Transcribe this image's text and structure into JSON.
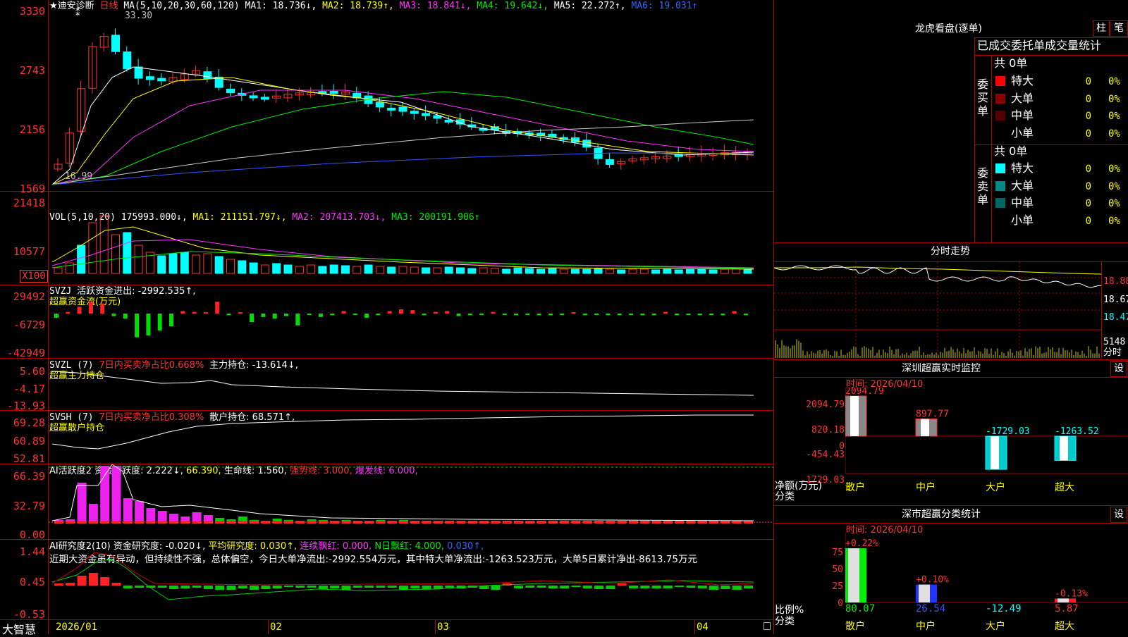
{
  "stock": {
    "name_line": "★迪安诊断",
    "period": "日线",
    "ma_label": "MA(5,10,20,30,60,120)",
    "ma": [
      "MA1: 18.736↓,",
      "MA2: 18.739↑,",
      "MA3: 18.841↓,",
      "MA4: 19.642↓,",
      "MA5: 22.272↑,",
      "MA6: 19.031↑"
    ],
    "high_mark": "33.30",
    "low_mark": "16.99",
    "y_ticks": [
      "3330",
      "2743",
      "2156",
      "1569"
    ]
  },
  "vol": {
    "label": "VOL(5,10,20)",
    "value": "175993.000↓,",
    "ma": [
      "MA1: 211151.797↓,",
      "MA2: 207413.703↓,",
      "MA3: 200191.906↑"
    ],
    "y_ticks": [
      "21418",
      "10577",
      "X100"
    ]
  },
  "svzj": {
    "label": "SVZJ",
    "text": "活跃资金进出: -2992.535↑,",
    "sub": "超赢资金流(万元)",
    "y_ticks": [
      "29492",
      "-6729",
      "-42949"
    ]
  },
  "svzl": {
    "label": "SVZL (7)",
    "ratio": "7日内买卖净占比0.668%",
    "text": "主力持仓: -13.614↓,",
    "sub": "超赢主力持仓",
    "y_ticks": [
      "5.60",
      "-4.17",
      "-13.93"
    ]
  },
  "svsh": {
    "label": "SVSH (7)",
    "ratio": "7日内买卖净占比0.308%",
    "text": "散户持仓: 68.571↑,",
    "sub": "超赢散户持仓",
    "y_ticks": [
      "69.28",
      "60.89",
      "52.81"
    ]
  },
  "ai1": {
    "label": "AI活跃度2",
    "items": [
      "资金活跃度: 2.222↓,",
      "66.390,",
      "生命线: 1.560,",
      "强势线: 3.000,",
      "爆发线: 6.000,"
    ],
    "y_ticks": [
      "66.39",
      "32.79",
      "0.00"
    ]
  },
  "ai2": {
    "label": "AI研究度2(10)",
    "items": [
      "资金研究度: -0.020↓,",
      "平均研究度: 0.030↑,",
      "连续飘红: 0.000,",
      "N日飘红: 4.000,",
      "0.030↑,"
    ],
    "note": "近期大资金虽有异动，但持续性不强，总体偏空，今日大单净流出:-2992.554万元，其中特大单净流出:-1263.523万元，大单5日累计净出-8613.75万元",
    "y_ticks": [
      "1.44",
      "0.45",
      "-0.53"
    ]
  },
  "xaxis": [
    "2026/01",
    "02",
    "03",
    "04"
  ],
  "brand": "大智慧",
  "lhb": {
    "title": "龙虎看盘(逐单)",
    "btn1": "柱",
    "btn2": "笔",
    "subtitle": "已成交委托单成交量统计",
    "buy_label": "委买单",
    "sell_label": "委卖单",
    "buy_total": "共 0单",
    "sell_total": "共 0单",
    "buy_rows": [
      {
        "name": "特大",
        "count": "0",
        "pct": "0%",
        "color": "#ff0000"
      },
      {
        "name": "大单",
        "count": "0",
        "pct": "0%",
        "color": "#880000"
      },
      {
        "name": "中单",
        "count": "0",
        "pct": "0%",
        "color": "#550000"
      },
      {
        "name": "小单",
        "count": "0",
        "pct": "0%",
        "color": "#000000"
      }
    ],
    "sell_rows": [
      {
        "name": "特大",
        "count": "0",
        "pct": "0%",
        "color": "#00ffff"
      },
      {
        "name": "大单",
        "count": "0",
        "pct": "0%",
        "color": "#008888"
      },
      {
        "name": "中单",
        "count": "0",
        "pct": "0%",
        "color": "#006666"
      },
      {
        "name": "小单",
        "count": "0",
        "pct": "0%",
        "color": "#000000"
      }
    ]
  },
  "intraday": {
    "title": "分时走势",
    "y_ticks": [
      "18.88",
      "18.67",
      "18.47"
    ],
    "vol_label": "5148",
    "time_label": "分时"
  },
  "monitor": {
    "title": "深圳超赢实时监控",
    "set": "设",
    "time": "时间: 2026/04/10",
    "y_ticks": [
      "2094.79",
      "820.18",
      "0",
      "-454.43",
      "-1729.03"
    ],
    "ylab1": "净额(万元)",
    "ylab2": "分类",
    "bars": [
      {
        "cat": "散户",
        "value": 2094.79,
        "label": "2094.79"
      },
      {
        "cat": "中户",
        "value": 897.77,
        "label": "897.77"
      },
      {
        "cat": "大户",
        "value": -1729.03,
        "label": "-1729.03"
      },
      {
        "cat": "超大",
        "value": -1263.52,
        "label": "-1263.52"
      }
    ]
  },
  "classify": {
    "title": "深市超赢分类统计",
    "set": "设",
    "time": "时间: 2026/04/10",
    "y_ticks": [
      "75",
      "50",
      "25",
      "0"
    ],
    "ylab1": "比例%",
    "ylab2": "分类",
    "bars": [
      {
        "cat": "散户",
        "value": 80.07,
        "label": "80.07",
        "top": "+0.22%"
      },
      {
        "cat": "中户",
        "value": 26.54,
        "label": "26.54",
        "top": "+0.10%"
      },
      {
        "cat": "大户",
        "value": -12.49,
        "label": "-12.49",
        "top": ""
      },
      {
        "cat": "超大",
        "value": 5.87,
        "label": "5.87",
        "top": "-0.13%"
      }
    ]
  },
  "chart_data": {
    "type": "bar",
    "title": "深圳超赢实时监控",
    "categories": [
      "散户",
      "中户",
      "大户",
      "超大"
    ],
    "values": [
      2094.79,
      897.77,
      -1729.03,
      -1263.52
    ],
    "ylabel": "净额(万元)",
    "ylim": [
      -1729.03,
      2094.79
    ]
  }
}
